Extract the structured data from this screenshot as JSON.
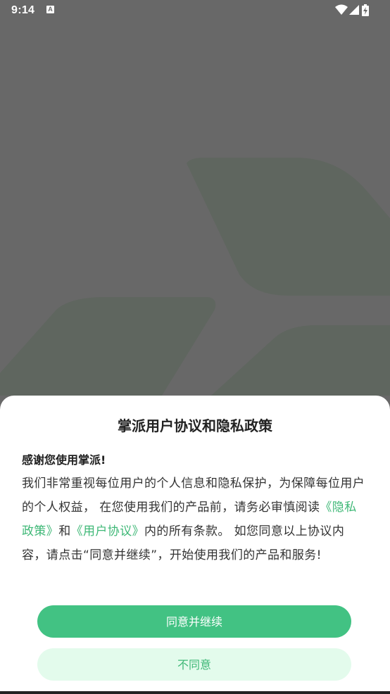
{
  "status_bar": {
    "time": "9:14",
    "icons": [
      "accessibility-a-icon",
      "wifi-icon",
      "signal-icon",
      "battery-charging-icon"
    ]
  },
  "dialog": {
    "title": "掌派用户协议和隐私政策",
    "greeting": "感谢您使用掌派!",
    "body_part1": "我们非常重视每位用户的个人信息和隐私保护，为保障每位用户的个人权益， 在您使用我们的产品前，请务必审慎阅读",
    "privacy_link": "《隐私政策》",
    "and_text": "和",
    "user_agreement_link": "《用户协议》",
    "body_part2": "内的所有条款。 如您同意以上协议内容，请点击“同意并继续”，开始使用我们的产品和服务!",
    "agree_label": "同意并继续",
    "disagree_label": "不同意"
  },
  "colors": {
    "accent": "#42c283",
    "link": "#3fb877",
    "disagree_bg": "#e3fbec",
    "overlay": "#686868"
  }
}
